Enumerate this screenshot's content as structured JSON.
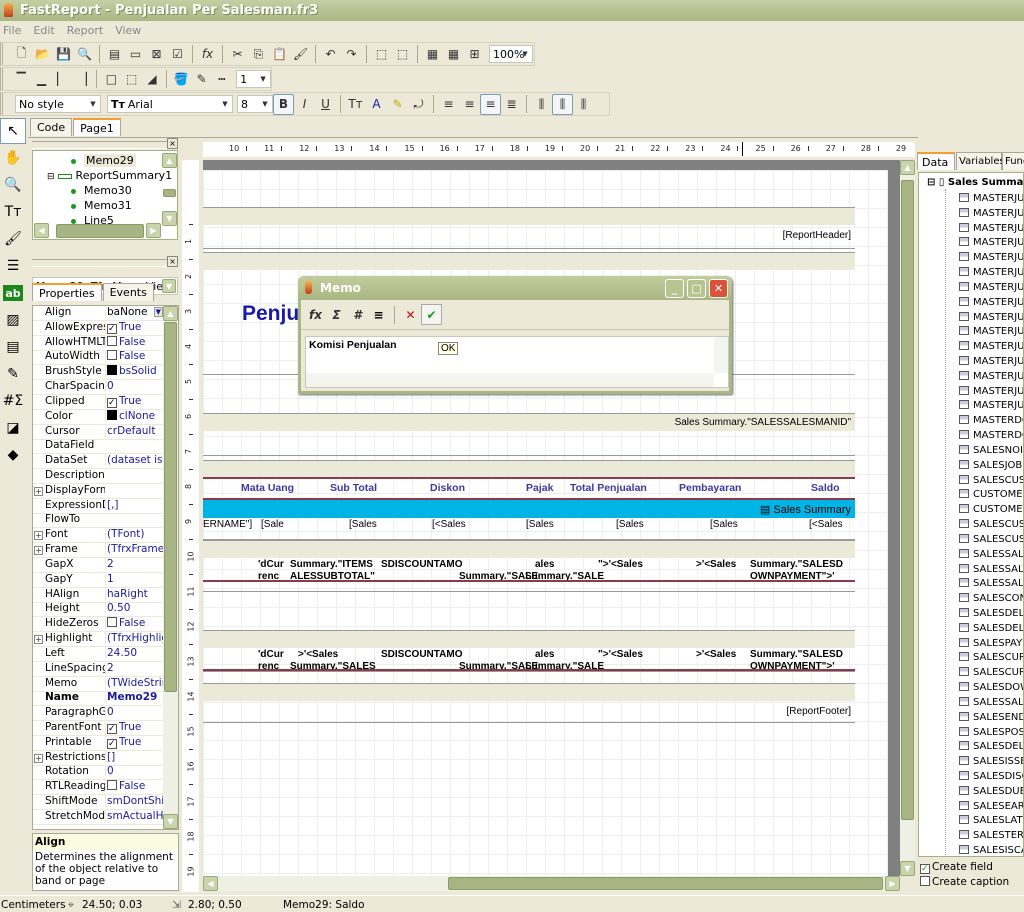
{
  "window": {
    "title": "FastReport - Penjualan Per Salesman.fr3"
  },
  "menu": [
    "File",
    "Edit",
    "Report",
    "View"
  ],
  "toolbar1": {
    "icons": [
      "new-icon",
      "open-icon",
      "save-icon",
      "preview-icon",
      "sep",
      "new-page-icon",
      "new-dialog-icon",
      "delete-page-icon",
      "page-settings-icon",
      "sep",
      "fx-icon",
      "sep",
      "cut-icon",
      "copy-icon",
      "paste-icon",
      "format-painter-icon",
      "sep",
      "undo-icon",
      "redo-icon",
      "sep",
      "group-icon",
      "ungroup-icon",
      "sep",
      "show-grid-icon",
      "snap-grid-icon",
      "fit-grid-icon"
    ],
    "glyphs": [
      "🗋",
      "📂",
      "💾",
      "🔍",
      "",
      "▤",
      "▭",
      "⊠",
      "☑",
      "",
      "fx",
      "",
      "✂",
      "⎘",
      "📋",
      "🖌",
      "",
      "↶",
      "↷",
      "",
      "⬚",
      "⬚",
      "",
      "▦",
      "▦",
      "⊞"
    ],
    "zoom": "100%"
  },
  "toolbar2": {
    "icons": [
      "frame-top-icon",
      "frame-bottom-icon",
      "frame-left-icon",
      "frame-right-icon",
      "sep",
      "frame-all-icon",
      "frame-none-icon",
      "shadow-icon",
      "sep",
      "fill-color-icon",
      "frame-color-icon",
      "frame-style-icon"
    ],
    "glyphs": [
      "▔",
      "▁",
      "▏",
      "▕",
      "",
      "□",
      "⬚",
      "◢",
      "",
      "🪣",
      "✎",
      "┅"
    ],
    "line_width": "1"
  },
  "toolbar3": {
    "style": "No style",
    "font": "Arial",
    "size": "8",
    "icons": [
      "bold-icon",
      "italic-icon",
      "underline-icon",
      "sep",
      "font-settings-icon",
      "font-color-icon",
      "highlight-icon",
      "rotation-icon",
      "sep",
      "align-left-icon",
      "align-center-icon",
      "align-right-icon",
      "justify-icon",
      "sep",
      "valign-top-icon",
      "valign-center-icon",
      "valign-bottom-icon"
    ],
    "glyphs": [
      "B",
      "I",
      "U",
      "",
      "Tт",
      "A",
      "✎",
      "⤾",
      "",
      "≡",
      "≡",
      "≡",
      "≣",
      "",
      "⫼",
      "⫼",
      "⫼"
    ],
    "active": [
      "bold-icon",
      "align-right-icon",
      "valign-center-icon"
    ]
  },
  "palette": {
    "icons": [
      "select-icon",
      "hand-icon",
      "zoom-icon",
      "text-edit-icon",
      "format-copy-icon",
      "band-icon",
      "text-object-icon",
      "picture-icon",
      "subreport-icon",
      "draw-icon",
      "system-text-icon",
      "shape-icon",
      "more-objects-icon"
    ],
    "glyphs": [
      "↖",
      "✋",
      "🔍",
      "Tт",
      "🖌",
      "☰",
      "ab",
      "▨",
      "▤",
      "✎",
      "#Σ",
      "◪",
      "◆"
    ]
  },
  "doc_tabs": [
    "Code",
    "Page1"
  ],
  "tree": [
    {
      "label": "Memo29",
      "level": 2,
      "selected": true
    },
    {
      "label": "ReportSummary1",
      "level": 1,
      "band": true
    },
    {
      "label": "Memo30",
      "level": 2
    },
    {
      "label": "Memo31",
      "level": 2
    },
    {
      "label": "Line5",
      "level": 2
    }
  ],
  "object_selector": "Memo29: TfrxMemoView",
  "inspector_tabs": [
    "Properties",
    "Events"
  ],
  "properties": [
    {
      "name": "Align",
      "value": "baNone",
      "dropdown": true
    },
    {
      "name": "AllowExpress",
      "value": "True",
      "check": true
    },
    {
      "name": "AllowHTMLTa",
      "value": "False",
      "check": false
    },
    {
      "name": "AutoWidth",
      "value": "False",
      "check": false
    },
    {
      "name": "BrushStyle",
      "value": "bsSolid",
      "swatch": "#000000"
    },
    {
      "name": "CharSpacing",
      "value": "0"
    },
    {
      "name": "Clipped",
      "value": "True",
      "check": true
    },
    {
      "name": "Color",
      "value": "clNone",
      "swatch": "#000000"
    },
    {
      "name": "Cursor",
      "value": "crDefault"
    },
    {
      "name": "DataField",
      "value": ""
    },
    {
      "name": "DataSet",
      "value": "(dataset is not assigned)"
    },
    {
      "name": "Description",
      "value": ""
    },
    {
      "name": "DisplayFormat",
      "value": "",
      "expand": true
    },
    {
      "name": "ExpressionDelimiters",
      "value": "[,]"
    },
    {
      "name": "FlowTo",
      "value": ""
    },
    {
      "name": "Font",
      "value": "(TFont)",
      "expand": true
    },
    {
      "name": "Frame",
      "value": "(TfrxFrame)",
      "expand": true
    },
    {
      "name": "GapX",
      "value": "2"
    },
    {
      "name": "GapY",
      "value": "1"
    },
    {
      "name": "HAlign",
      "value": "haRight"
    },
    {
      "name": "Height",
      "value": "0.50"
    },
    {
      "name": "HideZeros",
      "value": "False",
      "check": false
    },
    {
      "name": "Highlight",
      "value": "(TfrxHighlight)",
      "expand": true
    },
    {
      "name": "Left",
      "value": "24.50"
    },
    {
      "name": "LineSpacing",
      "value": "2"
    },
    {
      "name": "Memo",
      "value": "(TWideStrings)"
    },
    {
      "name": "Name",
      "value": "Memo29",
      "bold": true
    },
    {
      "name": "ParagraphGap",
      "value": "0"
    },
    {
      "name": "ParentFont",
      "value": "True",
      "check": true
    },
    {
      "name": "Printable",
      "value": "True",
      "check": true
    },
    {
      "name": "Restrictions",
      "value": "[]",
      "expand": true
    },
    {
      "name": "Rotation",
      "value": "0"
    },
    {
      "name": "RTLReading",
      "value": "False",
      "check": false
    },
    {
      "name": "ShiftMode",
      "value": "smDontShift"
    },
    {
      "name": "StretchMode",
      "value": "smActualHeight"
    }
  ],
  "help": {
    "title": "Align",
    "text": "Determines the alignment of the object relative to band or page"
  },
  "rulers": {
    "h": [
      10,
      11,
      12,
      13,
      14,
      15,
      16,
      17,
      18,
      19,
      20,
      21,
      22,
      23,
      24,
      25,
      26,
      27,
      28,
      29
    ],
    "v": [
      1,
      2,
      3,
      4,
      5,
      6,
      7,
      8,
      9,
      10,
      11,
      12,
      13,
      14,
      15,
      16,
      17,
      18,
      19
    ]
  },
  "report": {
    "report_header": "[ReportHeader]",
    "title_partial": "Penju",
    "group_header": "Sales Summary.\"SALESSALESMANID\"",
    "columns": [
      "Mata Uang",
      "Sub Total",
      "Diskon",
      "Pajak",
      "Total Penjualan",
      "Pembayaran",
      "Saldo"
    ],
    "master_band": "Sales Summary",
    "data_row": [
      "ERNAME\"]",
      "[Sale",
      "[Sales",
      "[<Sales",
      "[Sales",
      "[Sales",
      "[Sales",
      "[<Sales"
    ],
    "footer1_top": [
      "'dCur",
      "Summary.\"ITEMS",
      "SDISCOUNTAMO",
      "ales",
      "\">'<Sales",
      ">'<Sales",
      "Summary.\"SALESD"
    ],
    "footer1_bottom": [
      "renc",
      "ALESSUBTOTAL\"",
      "Summary.\"SALE",
      "Summary.\"SALE",
      "OWNPAYMENT\">'"
    ],
    "footer2_top": [
      "'dCur",
      ">'<Sales",
      "SDISCOUNTAMO",
      "ales",
      "\">'<Sales",
      ">'<Sales",
      "Summary.\"SALESD"
    ],
    "footer2_bottom": [
      "renc",
      "Summary.\"SALES",
      "Summary.\"SALE",
      "Summary.\"SALE",
      "OWNPAYMENT\">'"
    ],
    "report_footer": "[ReportFooter]"
  },
  "memo_dialog": {
    "title": "Memo",
    "text": "Komisi Penjualan",
    "tooltip": "OK",
    "tools": [
      "insert-expression-icon",
      "insert-aggregate-icon",
      "insert-format-icon",
      "word-wrap-icon",
      "cancel-icon",
      "ok-icon"
    ],
    "glyphs": [
      "fx",
      "Σ",
      "#",
      "≡",
      "✕",
      "✔"
    ]
  },
  "right_panel": {
    "tabs": [
      "Data",
      "Variables",
      "Functions"
    ],
    "root": "Sales Summary",
    "fields": [
      "MASTERJU",
      "MASTERJU",
      "MASTERJU",
      "MASTERJU",
      "MASTERJU",
      "MASTERJU",
      "MASTERJU",
      "MASTERJU",
      "MASTERJU",
      "MASTERJU",
      "MASTERJU",
      "MASTERJU",
      "MASTERJU",
      "MASTERJU",
      "MASTERJU",
      "MASTERDO",
      "MASTERDO",
      "SALESNOI",
      "SALESJOB",
      "SALESCUS",
      "CUSTOME",
      "CUSTOME",
      "SALESCUS",
      "SALESCUS",
      "SALESSAL",
      "SALESSAL",
      "SALESSAL",
      "SALESCON",
      "SALESDEL",
      "SALESDEL",
      "SALESPAY",
      "SALESCUR",
      "SALESCUR",
      "SALESDOW",
      "SALESSAL",
      "SALESEND",
      "SALESPOS",
      "SALESDEL",
      "SALESISSE",
      "SALESDISC",
      "SALESDUE",
      "SALESEAR",
      "SALESLAT",
      "SALESTER",
      "SALESISCA"
    ],
    "create_field": {
      "label": "Create field",
      "checked": true
    },
    "create_caption": {
      "label": "Create caption",
      "checked": false
    }
  },
  "status": {
    "units": "Centimeters",
    "position": "24.50; 0.03",
    "size": "2.80; 0.50",
    "selection": "Memo29: Saldo"
  },
  "colors": {
    "accent": "#a9b784",
    "band": "#ebe9d8",
    "master_band": "#00b4e6",
    "title_blue": "#1a1aa8"
  }
}
